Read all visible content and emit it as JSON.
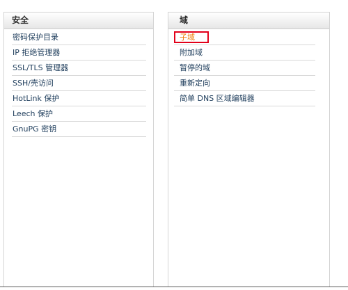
{
  "panels": [
    {
      "title": "安全",
      "items": [
        {
          "label": "密码保护目录"
        },
        {
          "label": "IP 拒绝管理器"
        },
        {
          "label": "SSL/TLS 管理器"
        },
        {
          "label": "SSH/壳访问"
        },
        {
          "label": "HotLink 保护"
        },
        {
          "label": "Leech 保护"
        },
        {
          "label": "GnuPG 密钥"
        }
      ]
    },
    {
      "title": "域",
      "items": [
        {
          "label": "子域",
          "highlighted": true
        },
        {
          "label": "附加域"
        },
        {
          "label": "暂停的域"
        },
        {
          "label": "重新定向"
        },
        {
          "label": "简单 DNS 区域编辑器"
        }
      ]
    }
  ],
  "colors": {
    "link": "#23415f",
    "highlight_text": "#f07a00",
    "highlight_border": "#e2001a",
    "panel_border": "#d4d4d4",
    "header_text": "#2b2b2b"
  }
}
